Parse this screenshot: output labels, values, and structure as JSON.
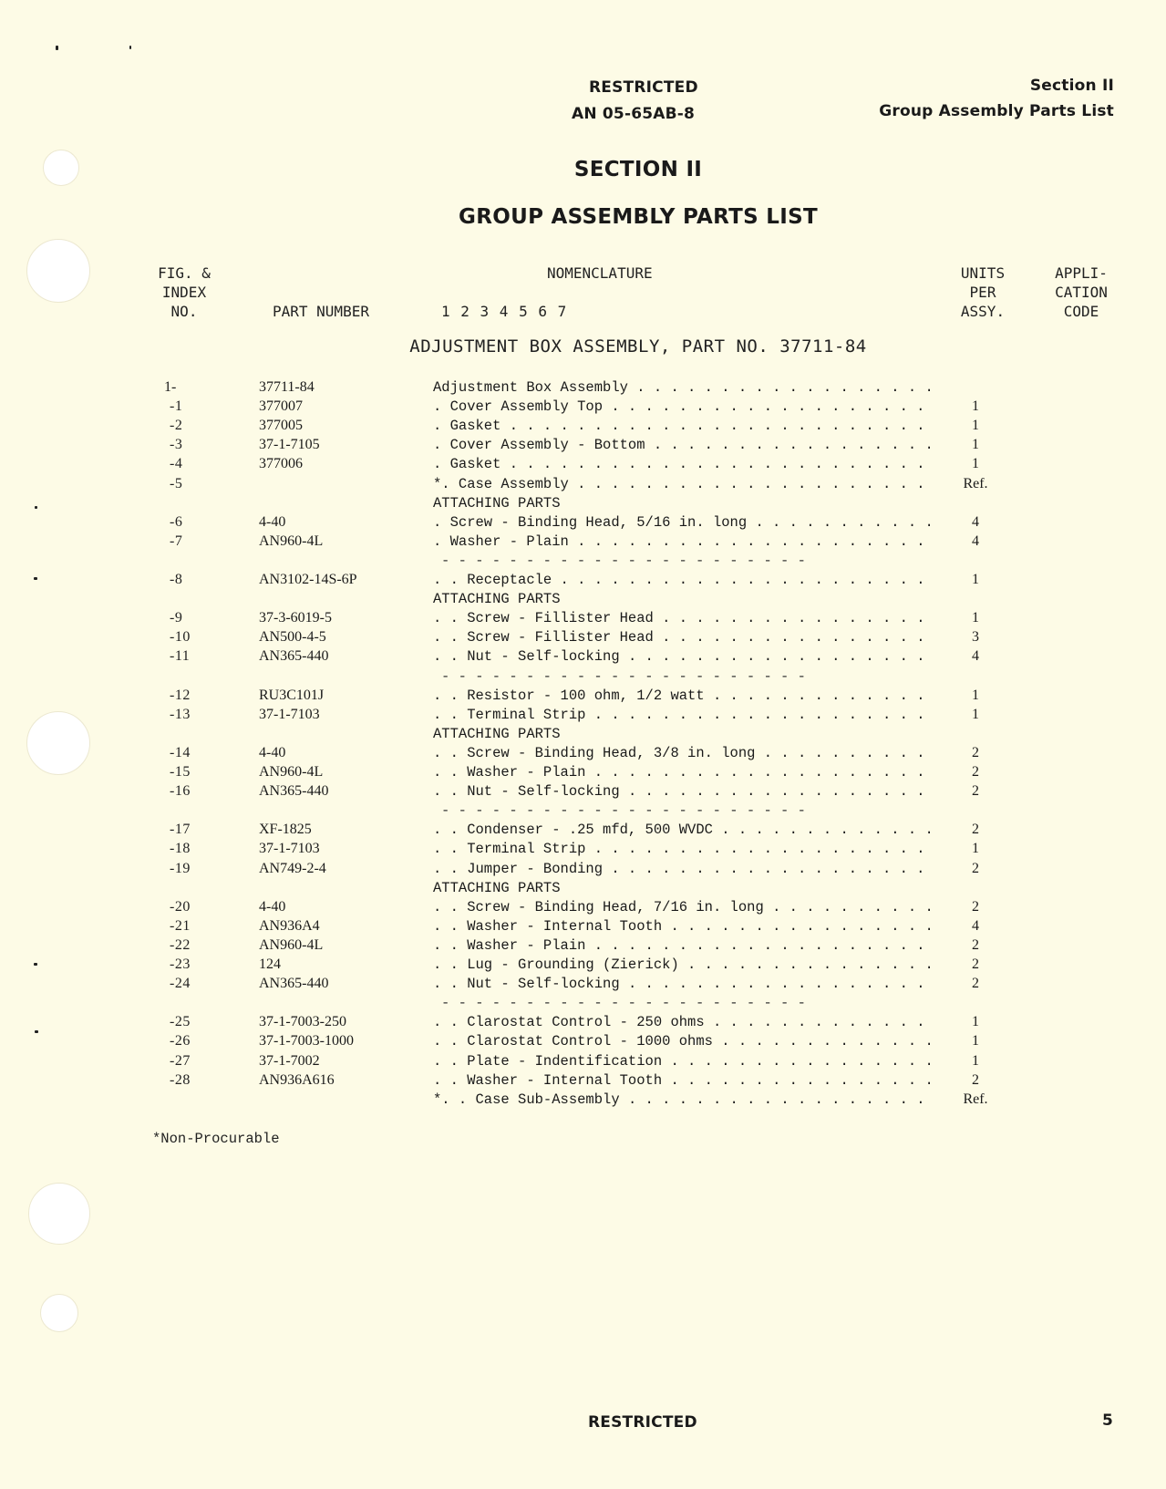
{
  "header": {
    "classification": "RESTRICTED",
    "document_number": "AN 05-65AB-8",
    "section": "Section II",
    "section_title": "Group Assembly Parts List"
  },
  "titles": {
    "section": "SECTION II",
    "main": "GROUP ASSEMBLY PARTS LIST"
  },
  "columns": {
    "fig_index": [
      "FIG. &",
      "INDEX",
      "NO."
    ],
    "part_number": "PART NUMBER",
    "nomenclature": "NOMENCLATURE",
    "indent_levels": "1 2 3 4 5 6 7",
    "units": [
      "UNITS",
      "PER",
      "ASSY."
    ],
    "application": [
      "APPLI-",
      "CATION",
      "CODE"
    ]
  },
  "assembly_title": "ADJUSTMENT BOX ASSEMBLY, PART NO. 37711-84",
  "rows": [
    {
      "type": "part",
      "index": "1-",
      "part": "37711-84",
      "nom": "Adjustment Box Assembly",
      "qty": ""
    },
    {
      "type": "part",
      "index": "-1",
      "part": "377007",
      "nom": ". Cover Assembly Top",
      "qty": "1"
    },
    {
      "type": "part",
      "index": "-2",
      "part": "377005",
      "nom": ". Gasket",
      "qty": "1"
    },
    {
      "type": "part",
      "index": "-3",
      "part": "37-1-7105",
      "nom": ". Cover Assembly - Bottom",
      "qty": "1"
    },
    {
      "type": "part",
      "index": "-4",
      "part": "377006",
      "nom": ". Gasket",
      "qty": "1"
    },
    {
      "type": "part",
      "index": "-5",
      "part": "",
      "nom": "*. Case Assembly",
      "qty": "Ref."
    },
    {
      "type": "attach",
      "label": "ATTACHING PARTS"
    },
    {
      "type": "part",
      "index": "-6",
      "part": "4-40",
      "nom": ". Screw - Binding Head, 5/16 in. long",
      "qty": "4"
    },
    {
      "type": "part",
      "index": "-7",
      "part": "AN960-4L",
      "nom": ". Washer - Plain",
      "qty": "4"
    },
    {
      "type": "dash"
    },
    {
      "type": "part",
      "index": "-8",
      "part": "AN3102-14S-6P",
      "nom": ". . Receptacle",
      "qty": "1"
    },
    {
      "type": "attach",
      "label": "ATTACHING PARTS"
    },
    {
      "type": "part",
      "index": "-9",
      "part": "37-3-6019-5",
      "nom": ". . Screw - Fillister Head",
      "qty": "1"
    },
    {
      "type": "part",
      "index": "-10",
      "part": "AN500-4-5",
      "nom": ". . Screw - Fillister Head",
      "qty": "3"
    },
    {
      "type": "part",
      "index": "-11",
      "part": "AN365-440",
      "nom": ". . Nut - Self-locking",
      "qty": "4"
    },
    {
      "type": "dash"
    },
    {
      "type": "part",
      "index": "-12",
      "part": "RU3C101J",
      "nom": ". . Resistor - 100 ohm, 1/2 watt",
      "qty": "1"
    },
    {
      "type": "part",
      "index": "-13",
      "part": "37-1-7103",
      "nom": ". . Terminal Strip",
      "qty": "1"
    },
    {
      "type": "attach",
      "label": "ATTACHING PARTS"
    },
    {
      "type": "part",
      "index": "-14",
      "part": "4-40",
      "nom": ". . Screw - Binding Head, 3/8 in. long",
      "qty": "2"
    },
    {
      "type": "part",
      "index": "-15",
      "part": "AN960-4L",
      "nom": ". . Washer - Plain",
      "qty": "2"
    },
    {
      "type": "part",
      "index": "-16",
      "part": "AN365-440",
      "nom": ". . Nut - Self-locking",
      "qty": "2"
    },
    {
      "type": "dash"
    },
    {
      "type": "part",
      "index": "-17",
      "part": "XF-1825",
      "nom": ". . Condenser - .25 mfd, 500 WVDC",
      "qty": "2"
    },
    {
      "type": "part",
      "index": "-18",
      "part": "37-1-7103",
      "nom": ". . Terminal Strip",
      "qty": "1"
    },
    {
      "type": "part",
      "index": "-19",
      "part": "AN749-2-4",
      "nom": ". . Jumper - Bonding",
      "qty": "2"
    },
    {
      "type": "attach",
      "label": "ATTACHING PARTS"
    },
    {
      "type": "part",
      "index": "-20",
      "part": "4-40",
      "nom": ". . Screw - Binding Head, 7/16 in. long",
      "qty": "2"
    },
    {
      "type": "part",
      "index": "-21",
      "part": "AN936A4",
      "nom": ". . Washer - Internal Tooth",
      "qty": "4"
    },
    {
      "type": "part",
      "index": "-22",
      "part": "AN960-4L",
      "nom": ". . Washer - Plain",
      "qty": "2"
    },
    {
      "type": "part",
      "index": "-23",
      "part": "124",
      "nom": ". . Lug - Grounding (Zierick)",
      "qty": "2"
    },
    {
      "type": "part",
      "index": "-24",
      "part": "AN365-440",
      "nom": ". . Nut - Self-locking",
      "qty": "2"
    },
    {
      "type": "dash"
    },
    {
      "type": "part",
      "index": "-25",
      "part": "37-1-7003-250",
      "nom": ". . Clarostat Control - 250 ohms",
      "qty": "1"
    },
    {
      "type": "part",
      "index": "-26",
      "part": "37-1-7003-1000",
      "nom": ". . Clarostat Control - 1000 ohms",
      "qty": "1"
    },
    {
      "type": "part",
      "index": "-27",
      "part": "37-1-7002",
      "nom": ". . Plate - Indentification",
      "qty": "1"
    },
    {
      "type": "part",
      "index": "-28",
      "part": "AN936A616",
      "nom": ". . Washer - Internal Tooth",
      "qty": "2"
    },
    {
      "type": "part",
      "index": "",
      "part": "",
      "nom": "*. . Case Sub-Assembly",
      "qty": "Ref."
    }
  ],
  "footnote": "*Non-Procurable",
  "footer": {
    "classification": "RESTRICTED",
    "page_number": "5"
  }
}
